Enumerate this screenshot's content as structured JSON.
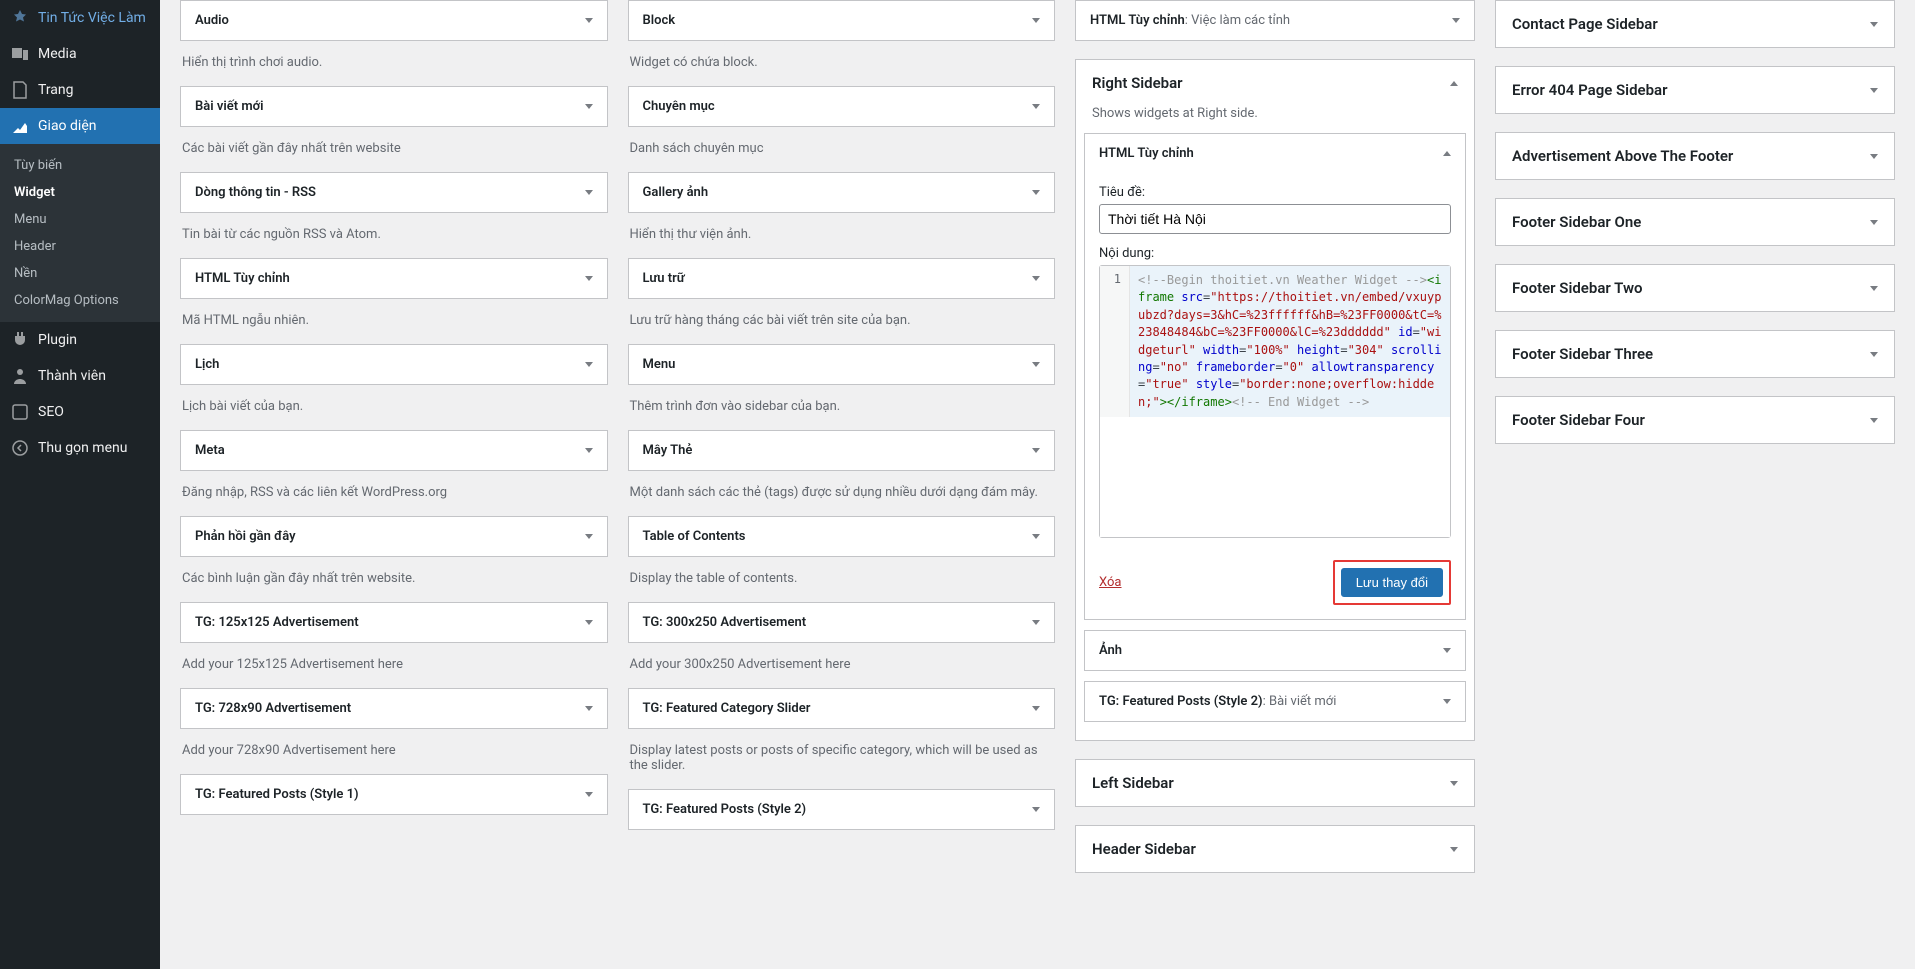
{
  "nav": {
    "items": [
      {
        "label": "Tin Tức Việc Làm",
        "icon": "pin"
      },
      {
        "label": "Media",
        "icon": "media"
      },
      {
        "label": "Trang",
        "icon": "page"
      },
      {
        "label": "Giao diện",
        "icon": "appearance",
        "current": true
      },
      {
        "label": "Plugin",
        "icon": "plugin"
      },
      {
        "label": "Thành viên",
        "icon": "user"
      },
      {
        "label": "SEO",
        "icon": "seo"
      },
      {
        "label": "Thu gọn menu",
        "icon": "collapse"
      }
    ],
    "sub": [
      {
        "label": "Tùy biến"
      },
      {
        "label": "Widget",
        "active": true
      },
      {
        "label": "Menu"
      },
      {
        "label": "Header"
      },
      {
        "label": "Nền"
      },
      {
        "label": "ColorMag Options"
      }
    ]
  },
  "available": {
    "left": [
      {
        "title": "Audio",
        "desc": "Hiển thị trình chơi audio."
      },
      {
        "title": "Bài viết mới",
        "desc": "Các bài viết gần đây nhất trên website"
      },
      {
        "title": "Dòng thông tin - RSS",
        "desc": "Tin bài từ các nguồn RSS và Atom."
      },
      {
        "title": "HTML Tùy chỉnh",
        "desc": "Mã HTML ngẫu nhiên."
      },
      {
        "title": "Lịch",
        "desc": "Lịch bài viết của bạn."
      },
      {
        "title": "Meta",
        "desc": "Đăng nhập, RSS và các liên kết WordPress.org"
      },
      {
        "title": "Phản hồi gần đây",
        "desc": "Các bình luận gần đây nhất trên website."
      },
      {
        "title": "TG: 125x125 Advertisement",
        "desc": "Add your 125x125 Advertisement here"
      },
      {
        "title": "TG: 728x90 Advertisement",
        "desc": "Add your 728x90 Advertisement here"
      },
      {
        "title": "TG: Featured Posts (Style 1)",
        "desc": ""
      }
    ],
    "right": [
      {
        "title": "Block",
        "desc": "Widget có chứa block."
      },
      {
        "title": "Chuyên mục",
        "desc": "Danh sách chuyên mục"
      },
      {
        "title": "Gallery ảnh",
        "desc": "Hiển thị thư viện ảnh."
      },
      {
        "title": "Lưu trữ",
        "desc": "Lưu trữ hàng tháng các bài viết trên site của bạn."
      },
      {
        "title": "Menu",
        "desc": "Thêm trình đơn vào sidebar của bạn."
      },
      {
        "title": "Mây Thẻ",
        "desc": "Một danh sách các thẻ (tags) được sử dụng nhiều dưới dạng đám mây."
      },
      {
        "title": "Table of Contents",
        "desc": "Display the table of contents."
      },
      {
        "title": "TG: 300x250 Advertisement",
        "desc": "Add your 300x250 Advertisement here"
      },
      {
        "title": "TG: Featured Category Slider",
        "desc": "Display latest posts or posts of specific category, which will be used as the slider."
      },
      {
        "title": "TG: Featured Posts (Style 2)",
        "desc": ""
      }
    ]
  },
  "center": {
    "top_widget": {
      "title": "HTML Tùy chỉnh",
      "sub": ": Việc làm các tỉnh"
    },
    "area_title": "Right Sidebar",
    "area_desc": "Shows widgets at Right side.",
    "widget_open_title": "HTML Tùy chỉnh",
    "form": {
      "title_label": "Tiêu đề:",
      "title_value": "Thời tiết Hà Nội",
      "content_label": "Nội dung:",
      "line_no": "1",
      "delete_text": "Xóa",
      "save_text": "Lưu thay đổi"
    },
    "widget_image": "Ảnh",
    "widget_featured": {
      "title": "TG: Featured Posts (Style 2)",
      "sub": ": Bài viết mới"
    },
    "left_sidebar": "Left Sidebar",
    "header_sidebar": "Header Sidebar"
  },
  "right_areas": [
    "Contact Page Sidebar",
    "Error 404 Page Sidebar",
    "Advertisement Above The Footer",
    "Footer Sidebar One",
    "Footer Sidebar Two",
    "Footer Sidebar Three",
    "Footer Sidebar Four"
  ]
}
